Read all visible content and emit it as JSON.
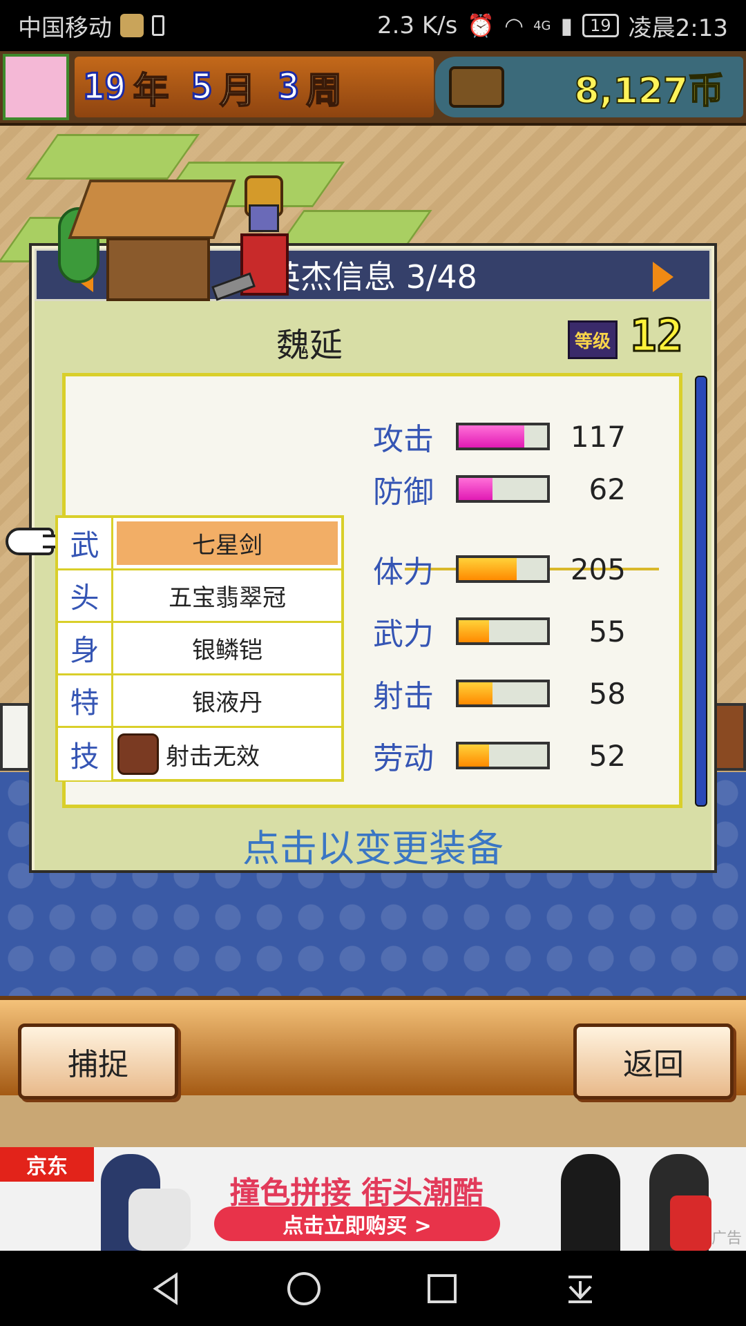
{
  "status_bar": {
    "carrier": "中国移动",
    "speed": "2.3 K/s",
    "network": "4G",
    "battery": "19",
    "time": "凌晨2:13"
  },
  "hud": {
    "year_num": "19",
    "year_unit": "年",
    "month_num": "5",
    "month_unit": "月",
    "week_num": "3",
    "week_unit": "周",
    "money": "8,127币"
  },
  "dialog": {
    "title": "英杰信息 3/48",
    "hero_name": "魏延",
    "level_badge": "等级",
    "level": "12",
    "equipment": [
      {
        "slot": "武",
        "item": "七星剑",
        "selected": true
      },
      {
        "slot": "头",
        "item": "五宝翡翠冠"
      },
      {
        "slot": "身",
        "item": "银鳞铠"
      },
      {
        "slot": "特",
        "item": "银液丹"
      },
      {
        "slot": "技",
        "item": "射击无效"
      }
    ],
    "stats_top": [
      {
        "label": "攻击",
        "value": "117",
        "fill": 0.74,
        "color": "pink"
      },
      {
        "label": "防御",
        "value": "62",
        "fill": 0.38,
        "color": "pink"
      }
    ],
    "stats_bottom": [
      {
        "label": "体力",
        "value": "205",
        "fill": 0.66,
        "color": "orange"
      },
      {
        "label": "武力",
        "value": "55",
        "fill": 0.34,
        "color": "orange"
      },
      {
        "label": "射击",
        "value": "58",
        "fill": 0.38,
        "color": "orange"
      },
      {
        "label": "劳动",
        "value": "52",
        "fill": 0.34,
        "color": "orange"
      }
    ],
    "hint": "点击以变更装备"
  },
  "buttons": {
    "capture": "捕捉",
    "back": "返回"
  },
  "ad": {
    "brand": "京东",
    "headline": "撞色拼接 街头潮酷",
    "cta": "点击立即购买 >",
    "tag": "广告"
  },
  "colors": {
    "accent_blue": "#3555b4",
    "pink_bar": "#e11ab4",
    "orange_bar": "#ff8a00"
  }
}
